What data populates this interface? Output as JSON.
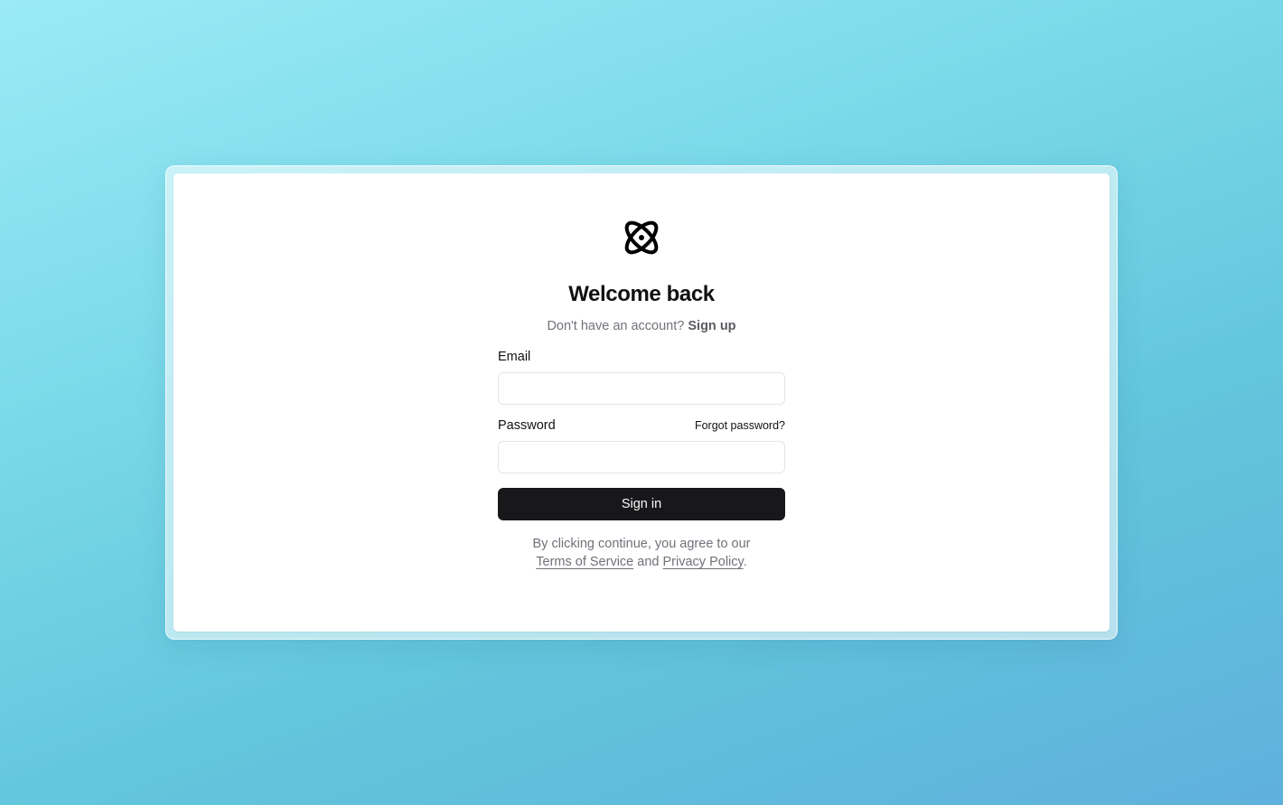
{
  "brand": {
    "logo_icon": "atom-icon",
    "logo_color": "#000000"
  },
  "login": {
    "title": "Welcome back",
    "no_account_text": "Don't have an account?",
    "sign_up_link": "Sign up",
    "email_label": "Email",
    "email_value": "",
    "password_label": "Password",
    "password_value": "",
    "forgot_password_link": "Forgot password?",
    "submit_label": "Sign in"
  },
  "legal": {
    "line1": "By clicking continue, you agree to our",
    "terms_link": "Terms of Service",
    "and_text": "and",
    "privacy_link": "Privacy Policy",
    "period": "."
  },
  "colors": {
    "primary_button": "#18181b",
    "primary_button_text": "#fafafa",
    "muted_text": "#71717a",
    "border": "#e4e4e7"
  }
}
